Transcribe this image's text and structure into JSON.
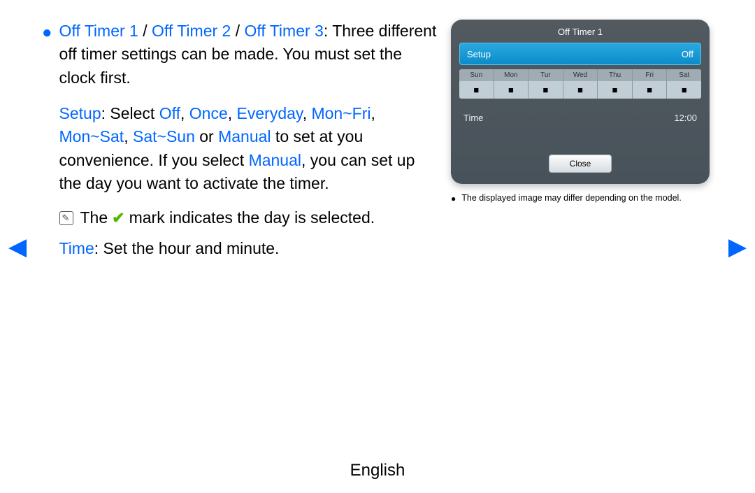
{
  "main": {
    "bullet_heading": {
      "off_timer_1": "Off Timer 1",
      "off_timer_2": "Off Timer 2",
      "off_timer_3": "Off Timer 3"
    },
    "intro_text": ": Three different off timer settings can be made. You must set the clock first.",
    "setup_label": "Setup",
    "setup_colon_text": ": Select ",
    "opt_off": "Off",
    "opt_once": "Once",
    "opt_everyday": "Everyday",
    "opt_monfri": "Mon~Fri",
    "opt_monsat": "Mon~Sat",
    "opt_satsun": "Sat~Sun",
    "opt_or": " or ",
    "opt_manual": "Manual",
    "setup_tail_1": " to set at you convenience. If you select ",
    "setup_tail_2": "Manual",
    "setup_tail_3": ", you can set up the day you want to activate the timer.",
    "note_the": "The",
    "note_text": "mark indicates the day is selected.",
    "time_label": "Time",
    "time_text": ": Set the hour and minute."
  },
  "panel": {
    "title": "Off Timer 1",
    "setup_label": "Setup",
    "setup_value": "Off",
    "days": [
      "Sun",
      "Mon",
      "Tur",
      "Wed",
      "Thu",
      "Fri",
      "Sat"
    ],
    "day_mark": "■",
    "time_label": "Time",
    "time_value": "12:00",
    "close": "Close",
    "note": "The displayed image may differ depending on the model."
  },
  "footer": {
    "language": "English"
  },
  "nav": {
    "left": "◀",
    "right": "▶"
  }
}
